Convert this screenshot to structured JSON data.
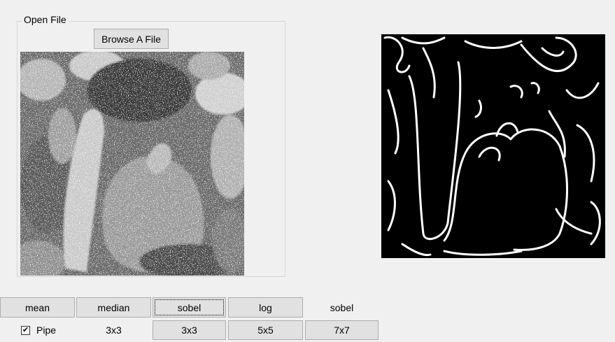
{
  "group": {
    "title": "Open File"
  },
  "browse_label": "Browse A File",
  "row1": {
    "mean": "mean",
    "median": "median",
    "sobel": "sobel",
    "log": "log",
    "label": "sobel"
  },
  "row2": {
    "pipe_label": "Pipe",
    "pipe_checked": "✔",
    "median_size": "3x3",
    "sobel_size": "3x3",
    "log_size": "5x5",
    "sobel2_size": "7x7"
  },
  "colors": {
    "window_bg": "#f0f0f0",
    "button_bg": "#e1e1e1",
    "button_border": "#adadad",
    "group_border": "#d5d5d5"
  }
}
